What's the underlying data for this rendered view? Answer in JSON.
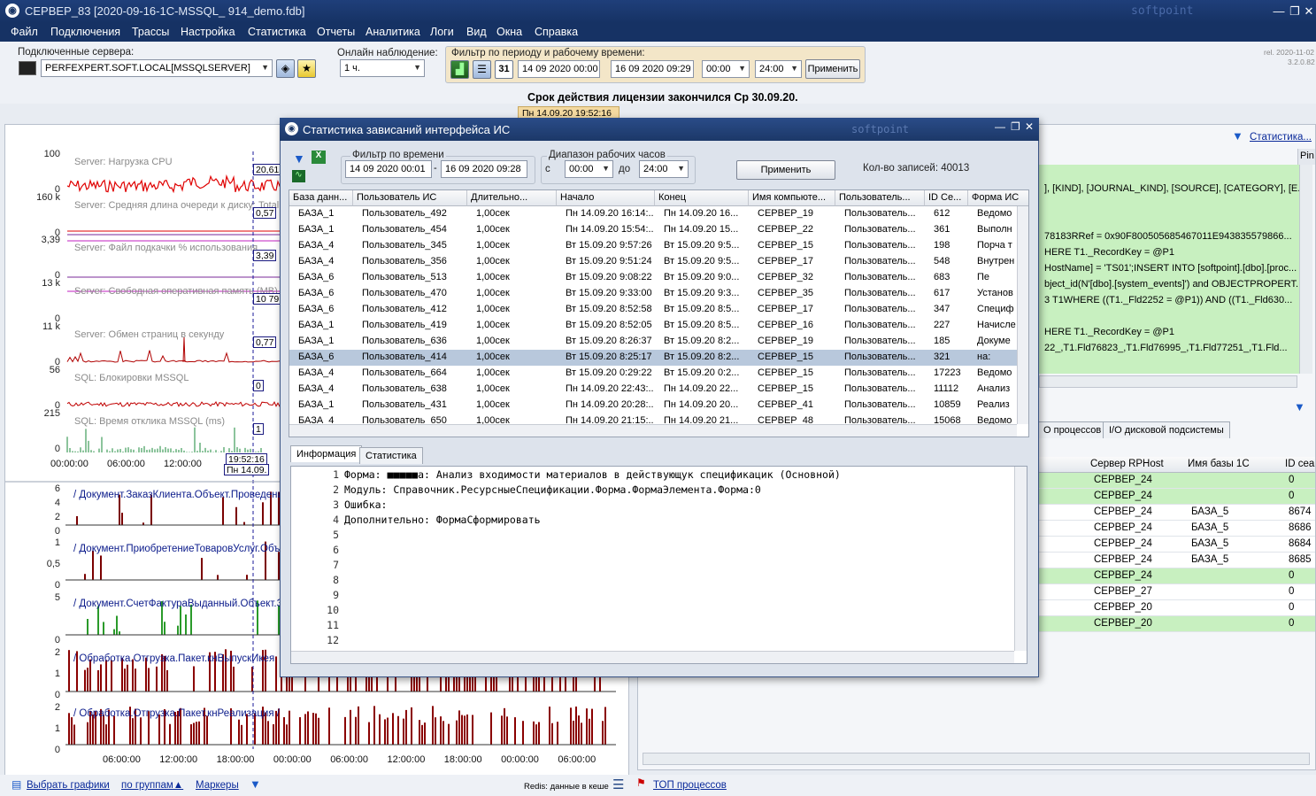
{
  "window": {
    "title": "СЕРВЕР_83  [2020-09-16-1C-MSSQL_                          914_demo.fdb]",
    "brand": "softpoint"
  },
  "menu": [
    "Файл",
    "Подключения",
    "Трассы",
    "Настройка",
    "Статистика",
    "Отчеты",
    "Аналитика",
    "Логи",
    "Вид",
    "Окна",
    "Справка"
  ],
  "toolbar": {
    "servers_label": "Подключенные сервера:",
    "server_value": "PERFEXPERT.SOFT.LOCAL[MSSQLSERVER]",
    "online_label": "Онлайн наблюдение:",
    "online_value": "1 ч.",
    "filter_label": "Фильтр по периоду и рабочему времени:",
    "calendar_glyph": "31",
    "date_from": "14 09 2020 00:00",
    "date_to": "16 09 2020 09:29",
    "time_from": "00:00",
    "time_to": "24:00",
    "apply": "Применить",
    "rel": "rel. 2020-11-02",
    "ver": "3.2.0.82"
  },
  "license": "Срок действия лицензии закончился Ср 30.09.20.",
  "timestamp_tab": "Пн 14.09.20 19:52:16",
  "left_charts": {
    "metrics": [
      {
        "name": "Server: Нагрузка CPU",
        "ymax": "100",
        "ymin": "0",
        "value": "20,61"
      },
      {
        "name": "Server: Средняя длина очереди к диску: Total",
        "ymax": "160 k",
        "ymin": "0",
        "value": "0,57"
      },
      {
        "name": "Server: Файл подкачки % использования",
        "ymax": "3,39",
        "ymin": "0",
        "value": "3,39"
      },
      {
        "name": "Server: Свободная оперативная память (MB)",
        "ymax": "13 k",
        "ymin": "0",
        "value": "10 79"
      },
      {
        "name": "Server: Обмен страниц в секунду",
        "ymax": "11 k",
        "ymin": "0",
        "value": "0,77"
      },
      {
        "name": "SQL: Блокировки MSSQL",
        "ymax": "56",
        "ymin": "0",
        "value": "0"
      },
      {
        "name": "SQL: Время отклика MSSQL (ms)",
        "ymax": "215",
        "ymin": "0",
        "value": "1"
      }
    ],
    "cursor_time": "19:52:16",
    "cursor_date": "Пн 14.09.",
    "x_top": [
      "00:00:00",
      "06:00:00",
      "12:00:00"
    ],
    "docs": [
      {
        "name": "/ Документ.ЗаказКлиента.Объект.Проведение",
        "y": [
          "6",
          "4",
          "2",
          "0"
        ]
      },
      {
        "name": "/ Документ.ПриобретениеТоваровУслуг.Объект",
        "y": [
          "1",
          "0,5",
          "0"
        ]
      },
      {
        "name": "/ Документ.СчетФактураВыданный.Объект.З",
        "y": [
          "5",
          "0"
        ]
      },
      {
        "name": "/ Обработка.Отгрузка.Пакет.кнВыпускИкея",
        "y": [
          "2",
          "1",
          "0"
        ]
      },
      {
        "name": "/ Обработка.Отгрузка.Пакет.кнРеализация /",
        "y": [
          "2",
          "1",
          "0"
        ]
      }
    ],
    "x_bottom": [
      "06:00:00",
      "12:00:00",
      "18:00:00",
      "00:00:00",
      "06:00:00",
      "12:00:00",
      "18:00:00",
      "00:00:00",
      "06:00:00"
    ]
  },
  "right_panel": {
    "stat_link": "Статистика...",
    "pin": "Pin",
    "sql_lines": [
      "], [KIND], [JOURNAL_KIND], [SOURCE], [CATEGORY], [E...",
      "",
      "",
      "78183RRef = 0x90F800505685467011E943835579866...",
      "HERE T1._RecordKey = @P1",
      "HostName] = 'TS01';INSERT INTO [softpoint].[dbo].[proc...",
      "bject_id(N'[dbo].[system_events]') and OBJECTPROPERT...",
      "3 T1WHERE ((T1._Fld2252 = @P1)) AND ((T1._Fld630...",
      "",
      "HERE T1._RecordKey = @P1",
      "22_,T1.Fld76823_,T1.Fld76995_,T1.Fld77251_,T1.Fld..."
    ],
    "tabs": [
      "О процессов",
      "I/O дисковой подсистемы"
    ],
    "cols": [
      "Сервер RPHost",
      "Имя базы 1С",
      "ID сеа"
    ],
    "rows": [
      [
        "СЕРВЕР_24",
        "",
        "0"
      ],
      [
        "СЕРВЕР_24",
        "",
        "0"
      ],
      [
        "СЕРВЕР_24",
        "БАЗА_5",
        "8674"
      ],
      [
        "СЕРВЕР_24",
        "БАЗА_5",
        "8686"
      ],
      [
        "СЕРВЕР_24",
        "БАЗА_5",
        "8684"
      ],
      [
        "СЕРВЕР_24",
        "БАЗА_5",
        "8685"
      ],
      [
        "СЕРВЕР_24",
        "",
        "0"
      ],
      [
        "СЕРВЕР_27",
        "",
        "0"
      ],
      [
        "СЕРВЕР_20",
        "",
        "0"
      ],
      [
        "СЕРВЕР_20",
        "",
        "0"
      ]
    ]
  },
  "modal": {
    "title": "Статистика зависаний интерфейса ИС",
    "brand": "softpoint",
    "time_filter_label": "Фильтр по времени",
    "from": "14 09 2020 00:01",
    "to": "16 09 2020 09:28",
    "hours_label": "Диапазон рабочих часов",
    "c": "с",
    "do": "до",
    "h_from": "00:00",
    "h_to": "24:00",
    "apply": "Применить",
    "count": "Кол-во записей: 40013",
    "columns": [
      "База данн...",
      "Пользователь ИС",
      "Длительно...",
      "Начало",
      "Конец",
      "Имя компьюте...",
      "Пользователь...",
      "ID Се...",
      "Форма ИС"
    ],
    "rows": [
      [
        "БАЗА_1",
        "Пользователь_492",
        "1,00сек",
        "Пн 14.09.20 16:14:...",
        "Пн 14.09.20 16...",
        "СЕРВЕР_19",
        "Пользователь...",
        "612",
        "Ведомо"
      ],
      [
        "БАЗА_1",
        "Пользователь_454",
        "1,00сек",
        "Пн 14.09.20 15:54:...",
        "Пн 14.09.20 15...",
        "СЕРВЕР_22",
        "Пользователь...",
        "361",
        "Выполн"
      ],
      [
        "БАЗА_4",
        "Пользователь_345",
        "1,00сек",
        "Вт 15.09.20 9:57:26",
        "Вт 15.09.20 9:5...",
        "СЕРВЕР_15",
        "Пользователь...",
        "198",
        "Порча т"
      ],
      [
        "БАЗА_4",
        "Пользователь_356",
        "1,00сек",
        "Вт 15.09.20 9:51:24",
        "Вт 15.09.20 9:5...",
        "СЕРВЕР_17",
        "Пользователь...",
        "548",
        "Внутрен"
      ],
      [
        "БАЗА_6",
        "Пользователь_513",
        "1,00сек",
        "Вт 15.09.20 9:08:22",
        "Вт 15.09.20 9:0...",
        "СЕРВЕР_32",
        "Пользователь...",
        "683",
        "Пе"
      ],
      [
        "БАЗА_6",
        "Пользователь_470",
        "1,00сек",
        "Вт 15.09.20 9:33:00",
        "Вт 15.09.20 9:3...",
        "СЕРВЕР_35",
        "Пользователь...",
        "617",
        "Установ"
      ],
      [
        "БАЗА_6",
        "Пользователь_412",
        "1,00сек",
        "Вт 15.09.20 8:52:58",
        "Вт 15.09.20 8:5...",
        "СЕРВЕР_17",
        "Пользователь...",
        "347",
        "Специф"
      ],
      [
        "БАЗА_1",
        "Пользователь_419",
        "1,00сек",
        "Вт 15.09.20 8:52:05",
        "Вт 15.09.20 8:5...",
        "СЕРВЕР_16",
        "Пользователь...",
        "227",
        "Начисле"
      ],
      [
        "БАЗА_1",
        "Пользователь_636",
        "1,00сек",
        "Вт 15.09.20 8:26:37",
        "Вт 15.09.20 8:2...",
        "СЕРВЕР_19",
        "Пользователь...",
        "185",
        "Докуме"
      ],
      [
        "БАЗА_6",
        "Пользователь_414",
        "1,00сек",
        "Вт 15.09.20 8:25:17",
        "Вт 15.09.20 8:2...",
        "СЕРВЕР_15",
        "Пользователь...",
        "321",
        "на:"
      ],
      [
        "БАЗА_4",
        "Пользователь_664",
        "1,00сек",
        "Вт 15.09.20 0:29:22",
        "Вт 15.09.20 0:2...",
        "СЕРВЕР_15",
        "Пользователь...",
        "17223",
        "Ведомо"
      ],
      [
        "БАЗА_4",
        "Пользователь_638",
        "1,00сек",
        "Пн 14.09.20 22:43:...",
        "Пн 14.09.20 22...",
        "СЕРВЕР_15",
        "Пользователь...",
        "11112",
        "Анализ"
      ],
      [
        "БАЗА_1",
        "Пользователь_431",
        "1,00сек",
        "Пн 14.09.20 20:28:...",
        "Пн 14.09.20 20...",
        "СЕРВЕР_41",
        "Пользователь...",
        "10859",
        "Реализ"
      ],
      [
        "БАЗА_4",
        "Пользователь_650",
        "1,00сек",
        "Пн 14.09.20 21:15:...",
        "Пн 14.09.20 21...",
        "СЕРВЕР_48",
        "Пользователь...",
        "15068",
        "Ведомо"
      ]
    ],
    "selected_row": 9,
    "tabs": [
      "Информация",
      "Статистика"
    ],
    "code_lines": [
      "Форма: ■■■■■а: Анализ входимости материалов в действующук спецификацик (Основной)",
      "Модуль: Справочник.РесурсныеСпецификации.Форма.ФормаЭлемента.Форма:0",
      "Ошибка:",
      "Дополнительно: ФормаСформировать",
      "",
      "",
      "",
      "",
      "",
      "",
      "",
      ""
    ]
  },
  "status": {
    "choose_charts": "Выбрать графики",
    "by_groups": "по группам▲",
    "markers": "Маркеры",
    "redis": "Redis: данные в кеше",
    "top": "ТОП процессов"
  },
  "colors": {
    "title_bg": "#1c3868",
    "accent_green": "#c8f0c0",
    "series_red": "#cc0000",
    "bar_dark": "#7a0000"
  }
}
